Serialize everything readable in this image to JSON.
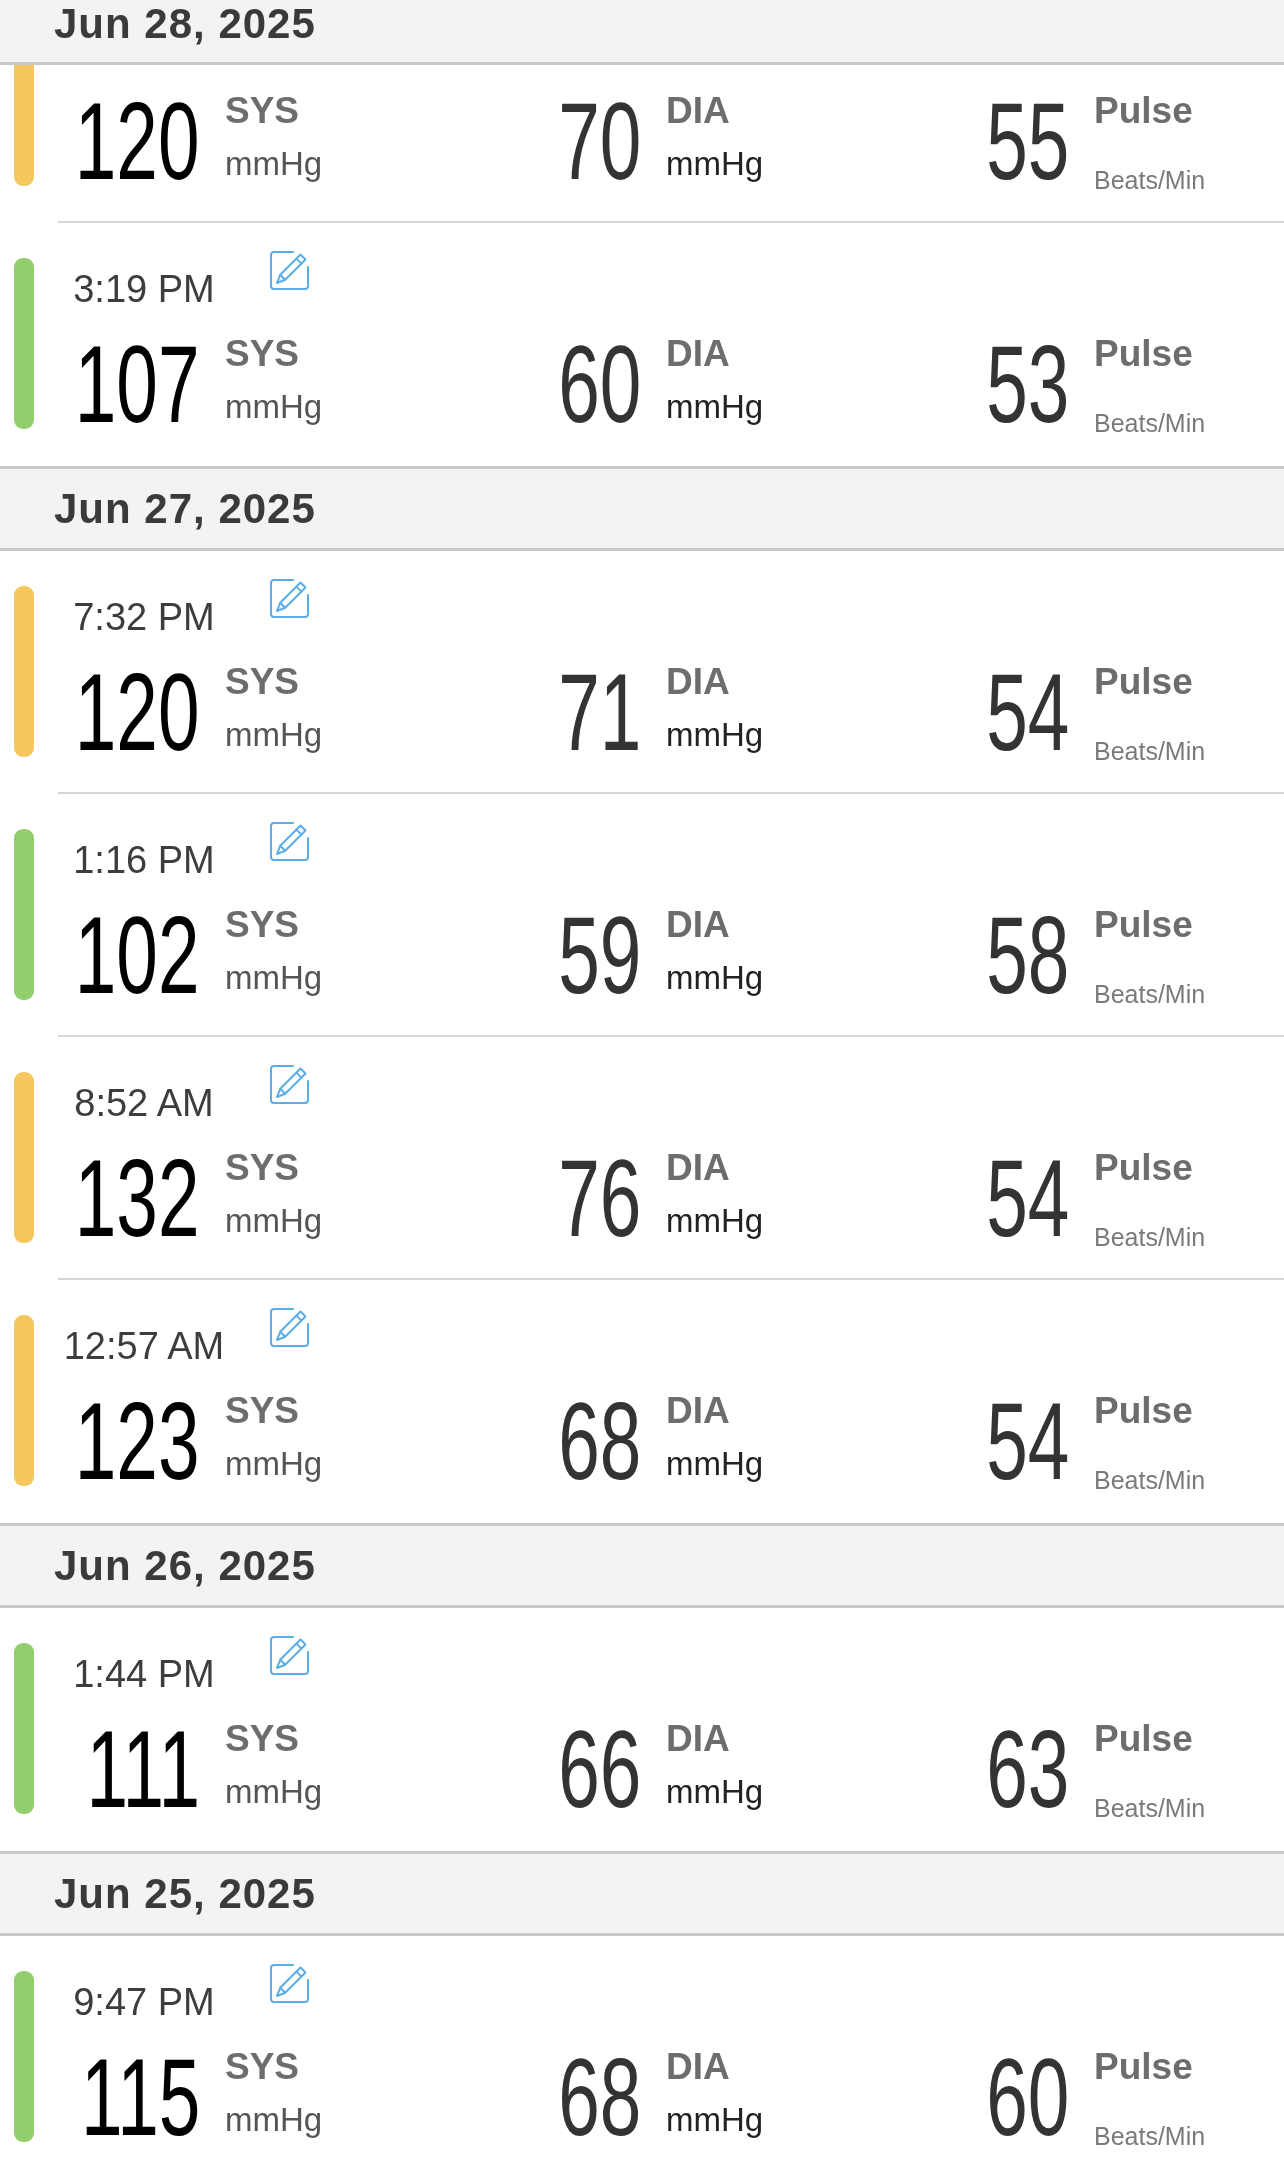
{
  "sections": [
    {
      "date": "Jun 28, 2025",
      "readings": [
        {
          "kind": "partial",
          "color": "#f6c75f",
          "measures": [
            {
              "kind": "systolic",
              "value": "120",
              "label": "SYS",
              "unit": "mmHg"
            },
            {
              "kind": "diastolic",
              "value": "70",
              "label": "DIA",
              "unit": "mmHg"
            },
            {
              "kind": "pulse",
              "value": "55",
              "label": "Pulse",
              "unit": "Beats/Min"
            }
          ]
        },
        {
          "kind": "entry",
          "time": "3:19 PM",
          "color": "#92ce6e",
          "measures": [
            {
              "kind": "systolic",
              "value": "107",
              "label": "SYS",
              "unit": "mmHg"
            },
            {
              "kind": "diastolic",
              "value": "60",
              "label": "DIA",
              "unit": "mmHg"
            },
            {
              "kind": "pulse",
              "value": "53",
              "label": "Pulse",
              "unit": "Beats/Min"
            }
          ]
        }
      ]
    },
    {
      "date": "Jun 27, 2025",
      "readings": [
        {
          "kind": "entry",
          "time": "7:32 PM",
          "color": "#f6c75f",
          "measures": [
            {
              "kind": "systolic",
              "value": "120",
              "label": "SYS",
              "unit": "mmHg"
            },
            {
              "kind": "diastolic",
              "value": "71",
              "label": "DIA",
              "unit": "mmHg"
            },
            {
              "kind": "pulse",
              "value": "54",
              "label": "Pulse",
              "unit": "Beats/Min"
            }
          ]
        },
        {
          "kind": "entry",
          "time": "1:16 PM",
          "color": "#92ce6e",
          "measures": [
            {
              "kind": "systolic",
              "value": "102",
              "label": "SYS",
              "unit": "mmHg"
            },
            {
              "kind": "diastolic",
              "value": "59",
              "label": "DIA",
              "unit": "mmHg"
            },
            {
              "kind": "pulse",
              "value": "58",
              "label": "Pulse",
              "unit": "Beats/Min"
            }
          ]
        },
        {
          "kind": "entry",
          "time": "8:52 AM",
          "color": "#f6c75f",
          "measures": [
            {
              "kind": "systolic",
              "value": "132",
              "label": "SYS",
              "unit": "mmHg"
            },
            {
              "kind": "diastolic",
              "value": "76",
              "label": "DIA",
              "unit": "mmHg"
            },
            {
              "kind": "pulse",
              "value": "54",
              "label": "Pulse",
              "unit": "Beats/Min"
            }
          ]
        },
        {
          "kind": "entry",
          "time": "12:57 AM",
          "color": "#f6c75f",
          "measures": [
            {
              "kind": "systolic",
              "value": "123",
              "label": "SYS",
              "unit": "mmHg"
            },
            {
              "kind": "diastolic",
              "value": "68",
              "label": "DIA",
              "unit": "mmHg"
            },
            {
              "kind": "pulse",
              "value": "54",
              "label": "Pulse",
              "unit": "Beats/Min"
            }
          ]
        }
      ]
    },
    {
      "date": "Jun 26, 2025",
      "readings": [
        {
          "kind": "entry",
          "time": "1:44 PM",
          "color": "#92ce6e",
          "measures": [
            {
              "kind": "systolic",
              "value": "111",
              "label": "SYS",
              "unit": "mmHg"
            },
            {
              "kind": "diastolic",
              "value": "66",
              "label": "DIA",
              "unit": "mmHg"
            },
            {
              "kind": "pulse",
              "value": "63",
              "label": "Pulse",
              "unit": "Beats/Min"
            }
          ]
        }
      ]
    },
    {
      "date": "Jun 25, 2025",
      "readings": [
        {
          "kind": "entry",
          "time": "9:47 PM",
          "color": "#92ce6e",
          "measures": [
            {
              "kind": "systolic",
              "value": "115",
              "label": "SYS",
              "unit": "mmHg"
            },
            {
              "kind": "diastolic",
              "value": "68",
              "label": "DIA",
              "unit": "mmHg"
            },
            {
              "kind": "pulse",
              "value": "60",
              "label": "Pulse",
              "unit": "Beats/Min"
            }
          ]
        }
      ]
    }
  ]
}
